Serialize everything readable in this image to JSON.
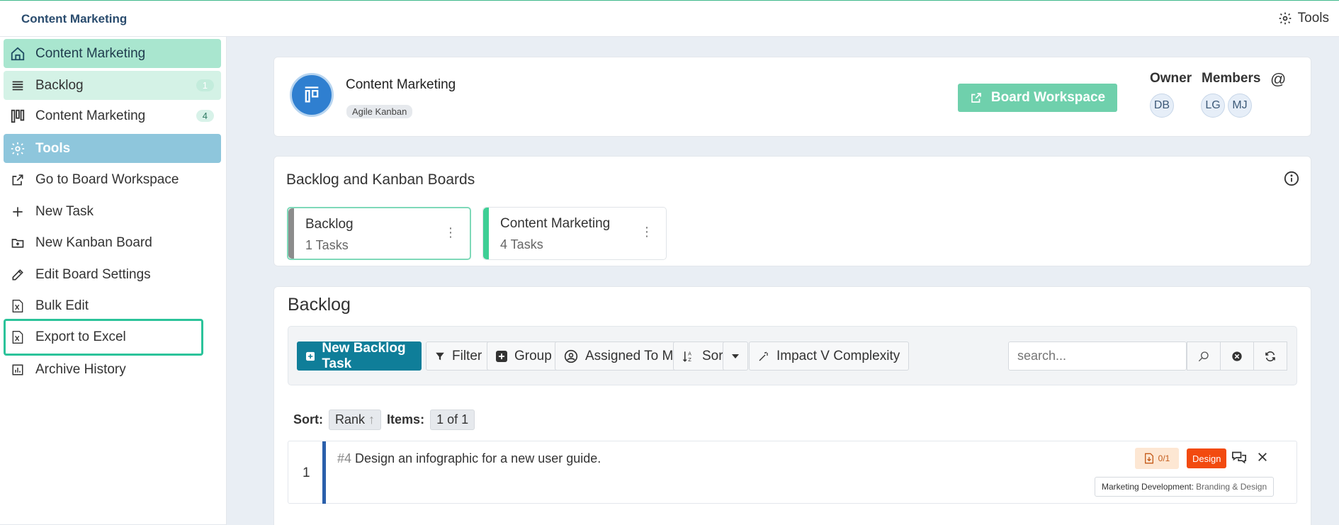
{
  "topbar": {
    "brand": "Content Marketing",
    "tools_label": "Tools"
  },
  "sidebar": {
    "items": [
      {
        "label": "Content Marketing",
        "icon": "home-icon"
      },
      {
        "label": "Backlog",
        "icon": "list-icon",
        "badge": "1"
      },
      {
        "label": "Content Marketing",
        "icon": "kanban-icon",
        "badge": "4"
      },
      {
        "label": "Tools",
        "icon": "gear-icon"
      },
      {
        "label": "Go to Board Workspace",
        "icon": "external-link-icon"
      },
      {
        "label": "New Task",
        "icon": "plus-icon"
      },
      {
        "label": "New Kanban Board",
        "icon": "folder-plus-icon"
      },
      {
        "label": "Edit Board Settings",
        "icon": "edit-icon"
      },
      {
        "label": "Bulk Edit",
        "icon": "excel-icon"
      },
      {
        "label": "Export to Excel",
        "icon": "excel-icon"
      },
      {
        "label": "Archive History",
        "icon": "chart-icon"
      }
    ]
  },
  "board": {
    "title": "Content Marketing",
    "tag": "Agile Kanban",
    "workspace_button": "Board Workspace",
    "owner_label": "Owner",
    "members_label": "Members",
    "at_symbol": "@",
    "owner": "DB",
    "members": [
      "LG",
      "MJ"
    ]
  },
  "boards_section": {
    "title": "Backlog and Kanban Boards",
    "boards": [
      {
        "name": "Backlog",
        "tasks": "1 Tasks",
        "color": "#8c8c8c"
      },
      {
        "name": "Content Marketing",
        "tasks": "4 Tasks",
        "color": "#3ecf95"
      }
    ]
  },
  "backlog": {
    "title": "Backlog",
    "toolbar": {
      "new_task": "New Backlog Task",
      "filter": "Filter",
      "group": "Group",
      "assigned": "Assigned To Me",
      "sort": "Sort",
      "impact": "Impact V Complexity",
      "search_placeholder": "search..."
    },
    "sort_label": "Sort:",
    "sort_value": "Rank",
    "items_label": "Items:",
    "items_value": "1 of 1",
    "tasks": [
      {
        "rank": "1",
        "id": "#4",
        "title": "Design an infographic for a new user guide.",
        "attachments": "0/1",
        "label": "Design",
        "category": "Marketing Development:",
        "subcategory": "Branding & Design"
      }
    ]
  },
  "colors": {
    "accent": "#3fb98b",
    "primary_button": "#0f7e99",
    "design_label": "#f24a0f"
  }
}
